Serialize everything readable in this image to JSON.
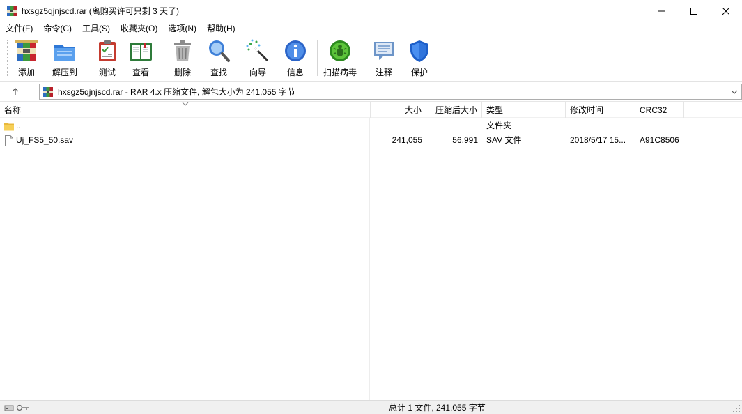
{
  "window": {
    "title": "hxsgz5qjnjscd.rar (离购买许可只剩 3 天了)",
    "controls": [
      "minimize-icon",
      "maximize-icon",
      "close-icon"
    ]
  },
  "menu": {
    "items": [
      "文件(F)",
      "命令(C)",
      "工具(S)",
      "收藏夹(O)",
      "选项(N)",
      "帮助(H)"
    ]
  },
  "toolbar": {
    "buttons": [
      {
        "label": "添加",
        "icon": "add-archive-icon"
      },
      {
        "label": "解压到",
        "icon": "extract-folder-icon"
      },
      {
        "label": "测试",
        "icon": "test-clipboard-icon"
      },
      {
        "label": "查看",
        "icon": "view-book-icon"
      },
      {
        "label": "删除",
        "icon": "trash-icon"
      },
      {
        "label": "查找",
        "icon": "magnifier-icon"
      },
      {
        "label": "向导",
        "icon": "wizard-wand-icon"
      },
      {
        "label": "信息",
        "icon": "info-icon"
      },
      {
        "label": "扫描病毒",
        "icon": "virus-scan-icon"
      },
      {
        "label": "注释",
        "icon": "comment-icon"
      },
      {
        "label": "保护",
        "icon": "shield-icon"
      }
    ]
  },
  "address": {
    "text": "hxsgz5qjnjscd.rar - RAR 4.x 压缩文件, 解包大小为 241,055 字节",
    "up_glyph": "🡑"
  },
  "columns": [
    "名称",
    "大小",
    "压缩后大小",
    "类型",
    "修改时间",
    "CRC32"
  ],
  "rows": [
    {
      "name": "..",
      "size": "",
      "packed": "",
      "type": "文件夹",
      "modified": "",
      "crc": "",
      "icon": "folder-icon"
    },
    {
      "name": "Uj_FS5_50.sav",
      "size": "241,055",
      "packed": "56,991",
      "type": "SAV 文件",
      "modified": "2018/5/17 15...",
      "crc": "A91C8506",
      "icon": "file-icon"
    }
  ],
  "status": {
    "text": "总计 1 文件, 241,055 字节"
  },
  "colors": {
    "accent_blue": "#1e6fd9",
    "green_scan": "#3aa420",
    "red_archive": "#c0272d"
  }
}
